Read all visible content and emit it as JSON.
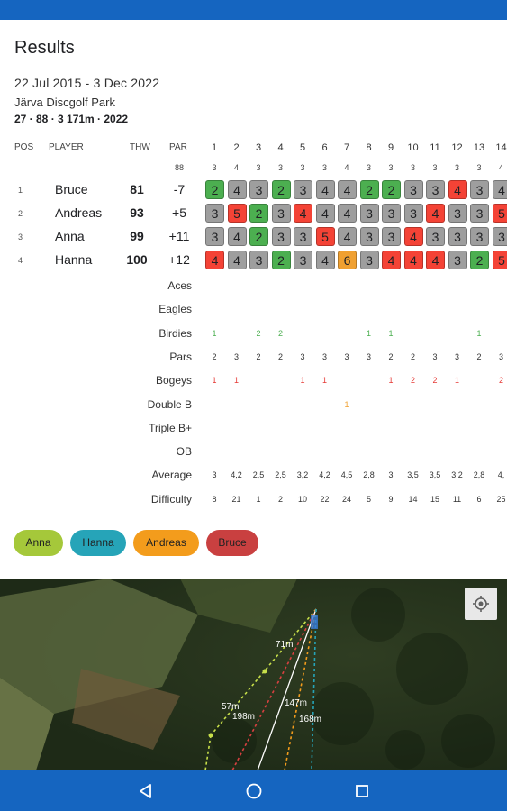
{
  "title": "Results",
  "date_range": "22 Jul 2015 - 3 Dec 2022",
  "course": "Järva Discgolf Park",
  "meta": "27 · 88 · 3 171m · 2022",
  "headers": {
    "pos": "POS",
    "player": "PLAYER",
    "thw": "THW",
    "par": "PAR",
    "par_total": "88"
  },
  "holes": [
    "1",
    "2",
    "3",
    "4",
    "5",
    "6",
    "7",
    "8",
    "9",
    "10",
    "11",
    "12",
    "13",
    "14"
  ],
  "hole_pars": [
    "3",
    "4",
    "3",
    "3",
    "3",
    "3",
    "4",
    "3",
    "3",
    "3",
    "3",
    "3",
    "3",
    "4"
  ],
  "players": [
    {
      "pos": "1",
      "name": "Bruce",
      "thw": "81",
      "par": "-7",
      "scores": [
        {
          "v": "2",
          "c": "green"
        },
        {
          "v": "4",
          "c": "gray"
        },
        {
          "v": "3",
          "c": "gray"
        },
        {
          "v": "2",
          "c": "green"
        },
        {
          "v": "3",
          "c": "gray"
        },
        {
          "v": "4",
          "c": "gray"
        },
        {
          "v": "4",
          "c": "gray"
        },
        {
          "v": "2",
          "c": "green"
        },
        {
          "v": "2",
          "c": "green"
        },
        {
          "v": "3",
          "c": "gray"
        },
        {
          "v": "3",
          "c": "gray"
        },
        {
          "v": "4",
          "c": "red"
        },
        {
          "v": "3",
          "c": "gray"
        },
        {
          "v": "4",
          "c": "gray"
        }
      ]
    },
    {
      "pos": "2",
      "name": "Andreas",
      "thw": "93",
      "par": "+5",
      "scores": [
        {
          "v": "3",
          "c": "gray"
        },
        {
          "v": "5",
          "c": "red"
        },
        {
          "v": "2",
          "c": "green"
        },
        {
          "v": "3",
          "c": "gray"
        },
        {
          "v": "4",
          "c": "red"
        },
        {
          "v": "4",
          "c": "gray"
        },
        {
          "v": "4",
          "c": "gray"
        },
        {
          "v": "3",
          "c": "gray"
        },
        {
          "v": "3",
          "c": "gray"
        },
        {
          "v": "3",
          "c": "gray"
        },
        {
          "v": "4",
          "c": "red"
        },
        {
          "v": "3",
          "c": "gray"
        },
        {
          "v": "3",
          "c": "gray"
        },
        {
          "v": "5",
          "c": "red"
        }
      ]
    },
    {
      "pos": "3",
      "name": "Anna",
      "thw": "99",
      "par": "+11",
      "scores": [
        {
          "v": "3",
          "c": "gray"
        },
        {
          "v": "4",
          "c": "gray"
        },
        {
          "v": "2",
          "c": "green"
        },
        {
          "v": "3",
          "c": "gray"
        },
        {
          "v": "3",
          "c": "gray"
        },
        {
          "v": "5",
          "c": "red"
        },
        {
          "v": "4",
          "c": "gray"
        },
        {
          "v": "3",
          "c": "gray"
        },
        {
          "v": "3",
          "c": "gray"
        },
        {
          "v": "4",
          "c": "red"
        },
        {
          "v": "3",
          "c": "gray"
        },
        {
          "v": "3",
          "c": "gray"
        },
        {
          "v": "3",
          "c": "gray"
        },
        {
          "v": "3",
          "c": "gray"
        }
      ]
    },
    {
      "pos": "4",
      "name": "Hanna",
      "thw": "100",
      "par": "+12",
      "scores": [
        {
          "v": "4",
          "c": "red"
        },
        {
          "v": "4",
          "c": "gray"
        },
        {
          "v": "3",
          "c": "gray"
        },
        {
          "v": "2",
          "c": "green"
        },
        {
          "v": "3",
          "c": "gray"
        },
        {
          "v": "4",
          "c": "gray"
        },
        {
          "v": "6",
          "c": "orange"
        },
        {
          "v": "3",
          "c": "gray"
        },
        {
          "v": "4",
          "c": "red"
        },
        {
          "v": "4",
          "c": "red"
        },
        {
          "v": "4",
          "c": "red"
        },
        {
          "v": "3",
          "c": "gray"
        },
        {
          "v": "2",
          "c": "green"
        },
        {
          "v": "5",
          "c": "red"
        }
      ]
    }
  ],
  "stats": [
    {
      "label": "Aces",
      "color": "dark",
      "values": [
        "",
        "",
        "",
        "",
        "",
        "",
        "",
        "",
        "",
        "",
        "",
        "",
        "",
        ""
      ]
    },
    {
      "label": "Eagles",
      "color": "dark",
      "values": [
        "",
        "",
        "",
        "",
        "",
        "",
        "",
        "",
        "",
        "",
        "",
        "",
        "",
        ""
      ]
    },
    {
      "label": "Birdies",
      "color": "green",
      "values": [
        "1",
        "",
        "2",
        "2",
        "",
        "",
        "",
        "1",
        "1",
        "",
        "",
        "",
        "1",
        ""
      ]
    },
    {
      "label": "Pars",
      "color": "dark",
      "values": [
        "2",
        "3",
        "2",
        "2",
        "3",
        "3",
        "3",
        "3",
        "2",
        "2",
        "3",
        "3",
        "2",
        "3"
      ]
    },
    {
      "label": "Bogeys",
      "color": "red",
      "values": [
        "1",
        "1",
        "",
        "",
        "1",
        "1",
        "",
        "",
        "1",
        "2",
        "2",
        "1",
        "",
        "2"
      ]
    },
    {
      "label": "Double B",
      "color": "orange",
      "values": [
        "",
        "",
        "",
        "",
        "",
        "",
        "1",
        "",
        "",
        "",
        "",
        "",
        "",
        ""
      ]
    },
    {
      "label": "Triple B+",
      "color": "dark",
      "values": [
        "",
        "",
        "",
        "",
        "",
        "",
        "",
        "",
        "",
        "",
        "",
        "",
        "",
        ""
      ]
    },
    {
      "label": "OB",
      "color": "dark",
      "values": [
        "",
        "",
        "",
        "",
        "",
        "",
        "",
        "",
        "",
        "",
        "",
        "",
        "",
        ""
      ]
    },
    {
      "label": "Average",
      "color": "dark",
      "values": [
        "3",
        "4,2",
        "2,5",
        "2,5",
        "3,2",
        "4,2",
        "4,5",
        "2,8",
        "3",
        "3,5",
        "3,5",
        "3,2",
        "2,8",
        "4,"
      ]
    },
    {
      "label": "Difficulty",
      "color": "dark",
      "values": [
        "8",
        "21",
        "1",
        "2",
        "10",
        "22",
        "24",
        "5",
        "9",
        "14",
        "15",
        "11",
        "6",
        "25"
      ]
    }
  ],
  "legend": [
    {
      "name": "Anna",
      "color": "#a5c83a"
    },
    {
      "name": "Hanna",
      "color": "#26a4b8"
    },
    {
      "name": "Andreas",
      "color": "#f39c1c"
    },
    {
      "name": "Bruce",
      "color": "#c94040"
    }
  ],
  "map": {
    "distances": [
      "71m",
      "57m",
      "198m",
      "147m",
      "168m"
    ],
    "location_icon": "my-location-icon"
  },
  "navbar": {
    "back_icon": "back-triangle-icon",
    "home_icon": "home-circle-icon",
    "recents_icon": "recents-square-icon"
  },
  "colors": {
    "primary": "#1565c0",
    "birdie": "#4caf50",
    "par": "#9e9e9e",
    "bogey": "#f44336",
    "double_bogey": "#f0a030"
  }
}
